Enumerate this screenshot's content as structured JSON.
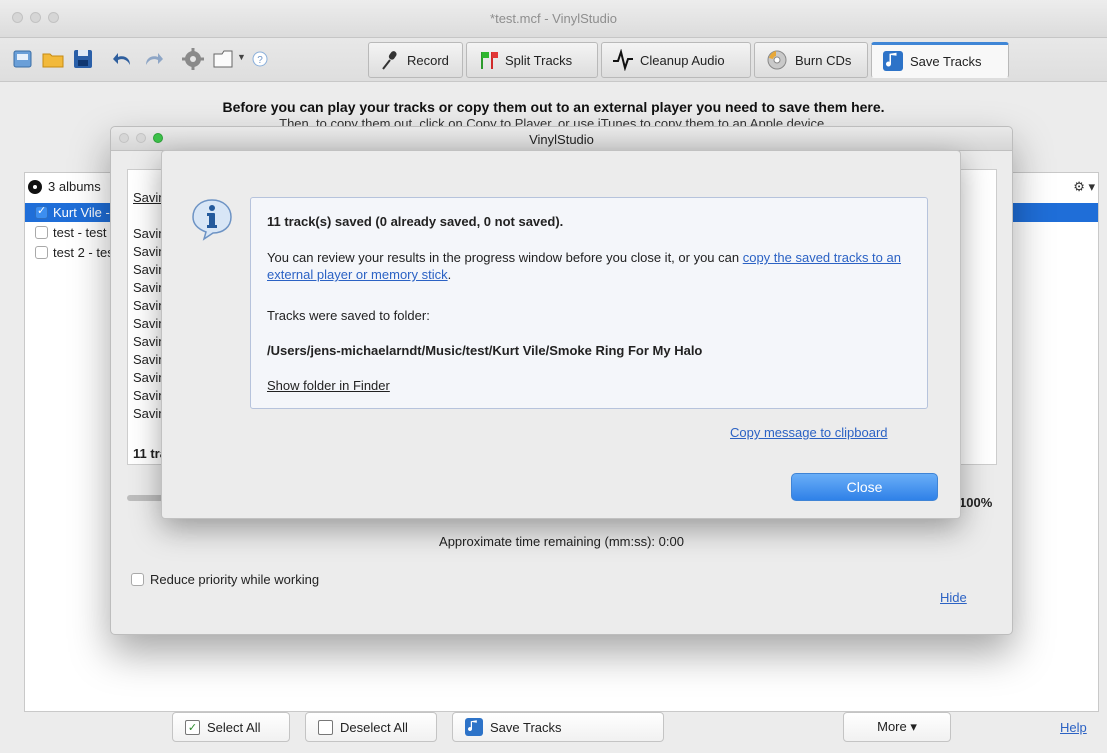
{
  "window": {
    "title": "*test.mcf - VinylStudio"
  },
  "toolbar": {
    "tabs": [
      {
        "label": "Record",
        "icon": "microphone-icon"
      },
      {
        "label": "Split Tracks",
        "icon": "flags-icon"
      },
      {
        "label": "Cleanup Audio",
        "icon": "waveform-icon"
      },
      {
        "label": "Burn CDs",
        "icon": "cd-icon"
      },
      {
        "label": "Save Tracks",
        "icon": "music-note-icon"
      }
    ]
  },
  "main": {
    "instruction": "Before you can play your tracks or copy them out to an external player you need to save them here.",
    "instruction2": "Then, to copy them out, click on Copy to Player, or use iTunes to copy them to an Apple device.",
    "albums_header": "3 albums",
    "albums": [
      {
        "label": "Kurt Vile - Smoke Ring For My Halo",
        "checked": true
      },
      {
        "label": "test - test",
        "checked": false
      },
      {
        "label": "test 2 - test",
        "checked": false
      }
    ],
    "gear_menu": "⚙ ▾"
  },
  "bottom": {
    "select_all": "Select All",
    "deselect_all": "Deselect All",
    "save_tracks": "Save Tracks",
    "more": "More  ▾",
    "help": "Help"
  },
  "progress": {
    "title": "VinylStudio",
    "header": "Saving tracks",
    "lines": [
      "Saving",
      "Saving",
      "Saving",
      "Saving",
      "Saving",
      "Saving",
      "Saving",
      "Saving",
      "Saving",
      "Saving",
      "Saving"
    ],
    "summary": "11 tracks saved",
    "percent": "100%",
    "approx": "Approximate time remaining (mm:ss): 0:00",
    "reduce": "Reduce priority while working",
    "hide": "Hide"
  },
  "alert": {
    "headline": "11 track(s) saved (0 already saved, 0 not saved).",
    "review_text": "You can review your results in the progress window before you close it, or you can ",
    "review_link": "copy the saved tracks to an external player or memory stick",
    "review_end": ".",
    "folder_label": "Tracks were saved to folder:",
    "folder_path": "/Users/jens-michaelarndt/Music/test/Kurt Vile/Smoke Ring For My Halo",
    "show_folder": "Show folder in Finder",
    "copy_clipboard": "Copy message to clipboard",
    "close": "Close"
  }
}
